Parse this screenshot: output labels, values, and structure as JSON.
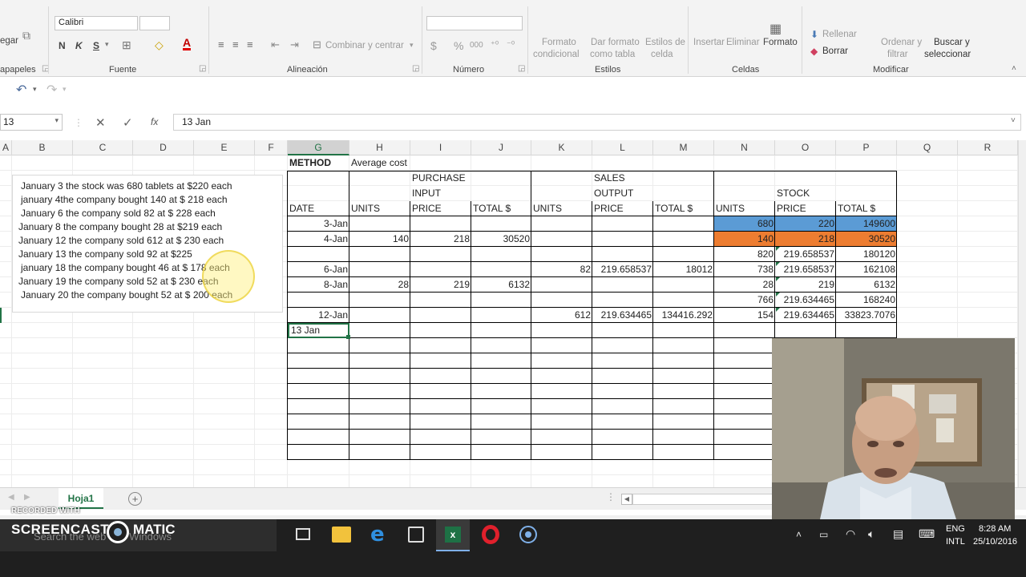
{
  "ribbon": {
    "clipboard_fragment": "egar",
    "clipboard_group": "apapeles",
    "font_name": "Calibri",
    "bold": "N",
    "italic": "K",
    "underline": "S",
    "font_group": "Fuente",
    "merge_label": "Combinar y centrar",
    "alignment_group": "Alineación",
    "currency": "$",
    "percent": "%",
    "thousands": "000",
    "number_group": "Número",
    "cond_format_1": "Formato",
    "cond_format_2": "condicional",
    "table_format_1": "Dar formato",
    "table_format_2": "como tabla",
    "cell_styles_1": "Estilos de",
    "cell_styles_2": "celda",
    "styles_group": "Estilos",
    "insert": "Insertar",
    "delete": "Eliminar",
    "format": "Formato",
    "cells_group": "Celdas",
    "fill": "Rellenar",
    "clear": "Borrar",
    "sort_1": "Ordenar y",
    "sort_2": "filtrar",
    "find_1": "Buscar y",
    "find_2": "seleccionar",
    "modify_group": "Modificar"
  },
  "formula_bar": {
    "name_box": "13",
    "cancel": "✕",
    "enter": "✓",
    "fx": "fx",
    "content": "13 Jan"
  },
  "columns": [
    "A",
    "B",
    "C",
    "D",
    "E",
    "F",
    "G",
    "H",
    "I",
    "J",
    "K",
    "L",
    "M",
    "N",
    "O",
    "P",
    "Q",
    "R"
  ],
  "textbox": [
    "January 3 the stock was 680 tablets at $220 each",
    "january 4the company bought 140 at $ 218 each",
    "January 6  the company sold 82 at $ 228 each",
    "January 8 the company bought 28 at $219 each",
    "January 12 the company sold 612 at $ 230 each",
    "January 13 the company sold 92 at $225",
    "january 18 the company bought 46 at $ 178 each",
    "January 19 the company sold 52 at $ 230 each",
    "January 20 the company bought 52 at $ 200 each"
  ],
  "sheet": {
    "method_label": "METHOD",
    "method_value": "Average cost",
    "purchase": "PURCHASE",
    "input": "INPUT",
    "sales": "SALES",
    "output": "OUTPUT",
    "stock": "STOCK",
    "headers": [
      "DATE",
      "UNITS",
      "PRICE",
      "TOTAL $",
      "UNITS",
      "PRICE",
      "TOTAL $",
      "UNITS",
      "PRICE",
      "TOTAL $"
    ],
    "rows": [
      [
        "3-Jan",
        "",
        "",
        "",
        "",
        "",
        "",
        "680",
        "220",
        "149600"
      ],
      [
        "4-Jan",
        "140",
        "218",
        "30520",
        "",
        "",
        "",
        "140",
        "218",
        "30520"
      ],
      [
        "",
        "",
        "",
        "",
        "",
        "",
        "",
        "820",
        "219.658537",
        "180120"
      ],
      [
        "6-Jan",
        "",
        "",
        "",
        "82",
        "219.658537",
        "18012",
        "738",
        "219.658537",
        "162108"
      ],
      [
        "8-Jan",
        "28",
        "219",
        "6132",
        "",
        "",
        "",
        "28",
        "219",
        "6132"
      ],
      [
        "",
        "",
        "",
        "",
        "",
        "",
        "",
        "766",
        "219.634465",
        "168240"
      ],
      [
        "12-Jan",
        "",
        "",
        "",
        "612",
        "219.634465",
        "134416.292",
        "154",
        "219.634465",
        "33823.7076"
      ]
    ],
    "editing_cell": "13 Jan",
    "blue": "#5b9bd5",
    "orange": "#ed7d31"
  },
  "sheet_tab": "Hoja1",
  "add_sheet": "+",
  "watermark": {
    "small": "RECORDED WITH",
    "brand": "SCREENCAST",
    "brand2": "MATIC"
  },
  "taskbar": {
    "search_placeholder": "Search the web and Windows",
    "lang_1": "ENG",
    "lang_2": "INTL",
    "time": "8:28 AM",
    "date": "25/10/2016"
  }
}
